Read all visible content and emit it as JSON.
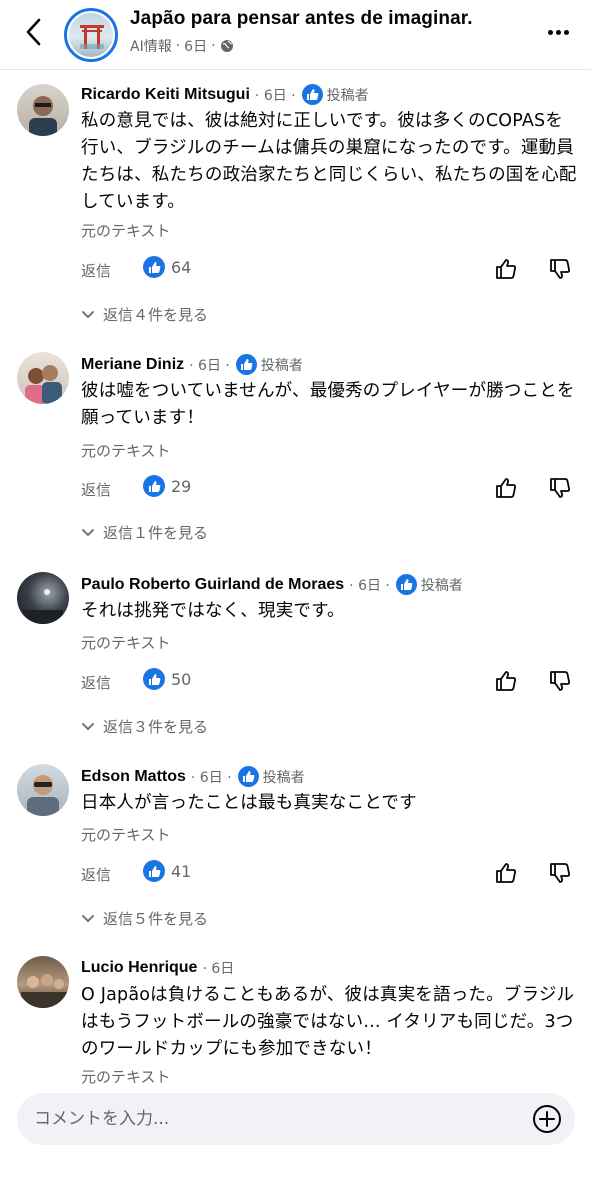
{
  "header": {
    "title": "Japão para pensar antes de imaginar.",
    "subtitle": "AI情報",
    "time": "6日"
  },
  "comments": [
    {
      "name": "Ricardo Keiti Mitsugui",
      "time": "6日",
      "author_label": "投稿者",
      "text": "私の意見では、彼は絶対に正しいです。彼は多くのCOPASを行い、ブラジルのチームは傭兵の巣窟になったのです。運動員たちは、私たちの政治家たちと同じくらい、私たちの国を心配しています。",
      "original_text": "元のテキスト",
      "reply": "返信",
      "likes": "64",
      "view_replies": "返信４件を見る"
    },
    {
      "name": "Meriane Diniz",
      "time": "6日",
      "author_label": "投稿者",
      "text": "彼は嘘をついていませんが、最優秀のプレイヤーが勝つことを願っています！",
      "original_text": "元のテキスト",
      "reply": "返信",
      "likes": "29",
      "view_replies": "返信１件を見る"
    },
    {
      "name": "Paulo Roberto Guirland de Moraes",
      "time": "6日",
      "author_label": "投稿者",
      "text": "それは挑発ではなく、現実です。",
      "original_text": "元のテキスト",
      "reply": "返信",
      "likes": "50",
      "view_replies": "返信３件を見る"
    },
    {
      "name": "Edson Mattos",
      "time": "6日",
      "author_label": "投稿者",
      "text": "日本人が言ったことは最も真実なことです",
      "original_text": "元のテキスト",
      "reply": "返信",
      "likes": "41",
      "view_replies": "返信５件を見る"
    },
    {
      "name": "Lucio Henrique",
      "time": "6日",
      "text": "O Japãoは負けることもあるが、彼は真実を語った。ブラジルはもうフットボールの強豪ではない... イタリアも同じだ。3つのワールドカップにも参加できない！",
      "original_text": "元のテキスト"
    }
  ],
  "composer": {
    "placeholder": "コメントを入力..."
  },
  "colors": {
    "accent": "#1b74e4",
    "secondary_text": "#65676b",
    "input_background": "#f0f2f5"
  }
}
